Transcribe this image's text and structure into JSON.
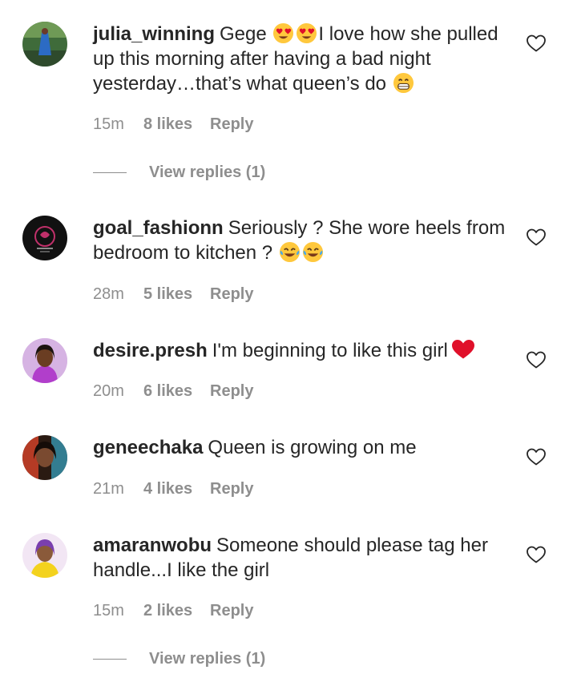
{
  "comments": [
    {
      "username": "julia_winning",
      "text_before": "Gege ",
      "text_after": "I love how she pulled up this morning after having a bad night yesterday…that’s what queen’s do ",
      "time": "15m",
      "likes": "8 likes",
      "reply": "Reply",
      "view_replies": "View replies (1)",
      "emojis": [
        "heart-eyes-emoji",
        "heart-eyes-emoji",
        "grinning-emoji"
      ]
    },
    {
      "username": "goal_fashionn",
      "text": "Seriously ? She wore heels from bedroom to kitchen ? ",
      "time": "28m",
      "likes": "5 likes",
      "reply": "Reply",
      "emojis": [
        "tears-of-joy-emoji",
        "tears-of-joy-emoji"
      ]
    },
    {
      "username": "desire.presh",
      "text": "I'm beginning to like this girl",
      "time": "20m",
      "likes": "6 likes",
      "reply": "Reply",
      "emojis": [
        "red-heart-emoji"
      ]
    },
    {
      "username": "geneechaka",
      "text": "Queen is growing on me",
      "time": "21m",
      "likes": "4 likes",
      "reply": "Reply"
    },
    {
      "username": "amaranwobu",
      "text": "Someone should please tag her handle...I like the girl",
      "time": "15m",
      "likes": "2 likes",
      "reply": "Reply",
      "view_replies": "View replies (1)"
    }
  ],
  "icons": {
    "like": "heart-outline-icon"
  },
  "colors": {
    "text": "#262626",
    "muted": "#8e8e8e",
    "heart_red": "#e0102a",
    "emoji_yellow": "#ffc83d"
  }
}
